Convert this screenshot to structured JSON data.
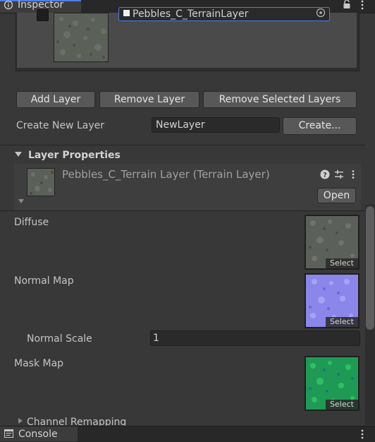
{
  "tabs": {
    "inspector_title": "Inspector",
    "console_title": "Console"
  },
  "layer_list": {
    "selected_layer_name": "Pebbles_C_TerrainLayer",
    "selected_layer_swatch": "#efefef"
  },
  "buttons": {
    "add_layer": "Add Layer",
    "remove_layer": "Remove Layer",
    "remove_selected_layers": "Remove Selected Layers",
    "create": "Create...",
    "open": "Open"
  },
  "create_new_layer": {
    "label": "Create New Layer",
    "value": "NewLayer"
  },
  "layer_properties": {
    "section_title": "Layer Properties",
    "asset_name": "Pebbles_C_Terrain Layer (Terrain Layer)",
    "fields": {
      "diffuse": "Diffuse",
      "normal_map": "Normal Map",
      "normal_scale": "Normal Scale",
      "normal_scale_value": "1",
      "mask_map": "Mask Map",
      "channel_remapping": "Channel Remapping"
    },
    "texture_select_label": "Select"
  },
  "icons": {
    "inspector": "info-icon",
    "lock": "lock-icon",
    "menu": "kebab-menu-icon",
    "help": "help-icon",
    "preset": "preset-icon",
    "object_picker": "target-icon",
    "console": "console-icon"
  },
  "colors": {
    "accent": "#4d7ee8",
    "panel_bg": "#383838",
    "normal_map_tint": "#8a86ea",
    "mask_map_tint": "#1f9a55"
  }
}
